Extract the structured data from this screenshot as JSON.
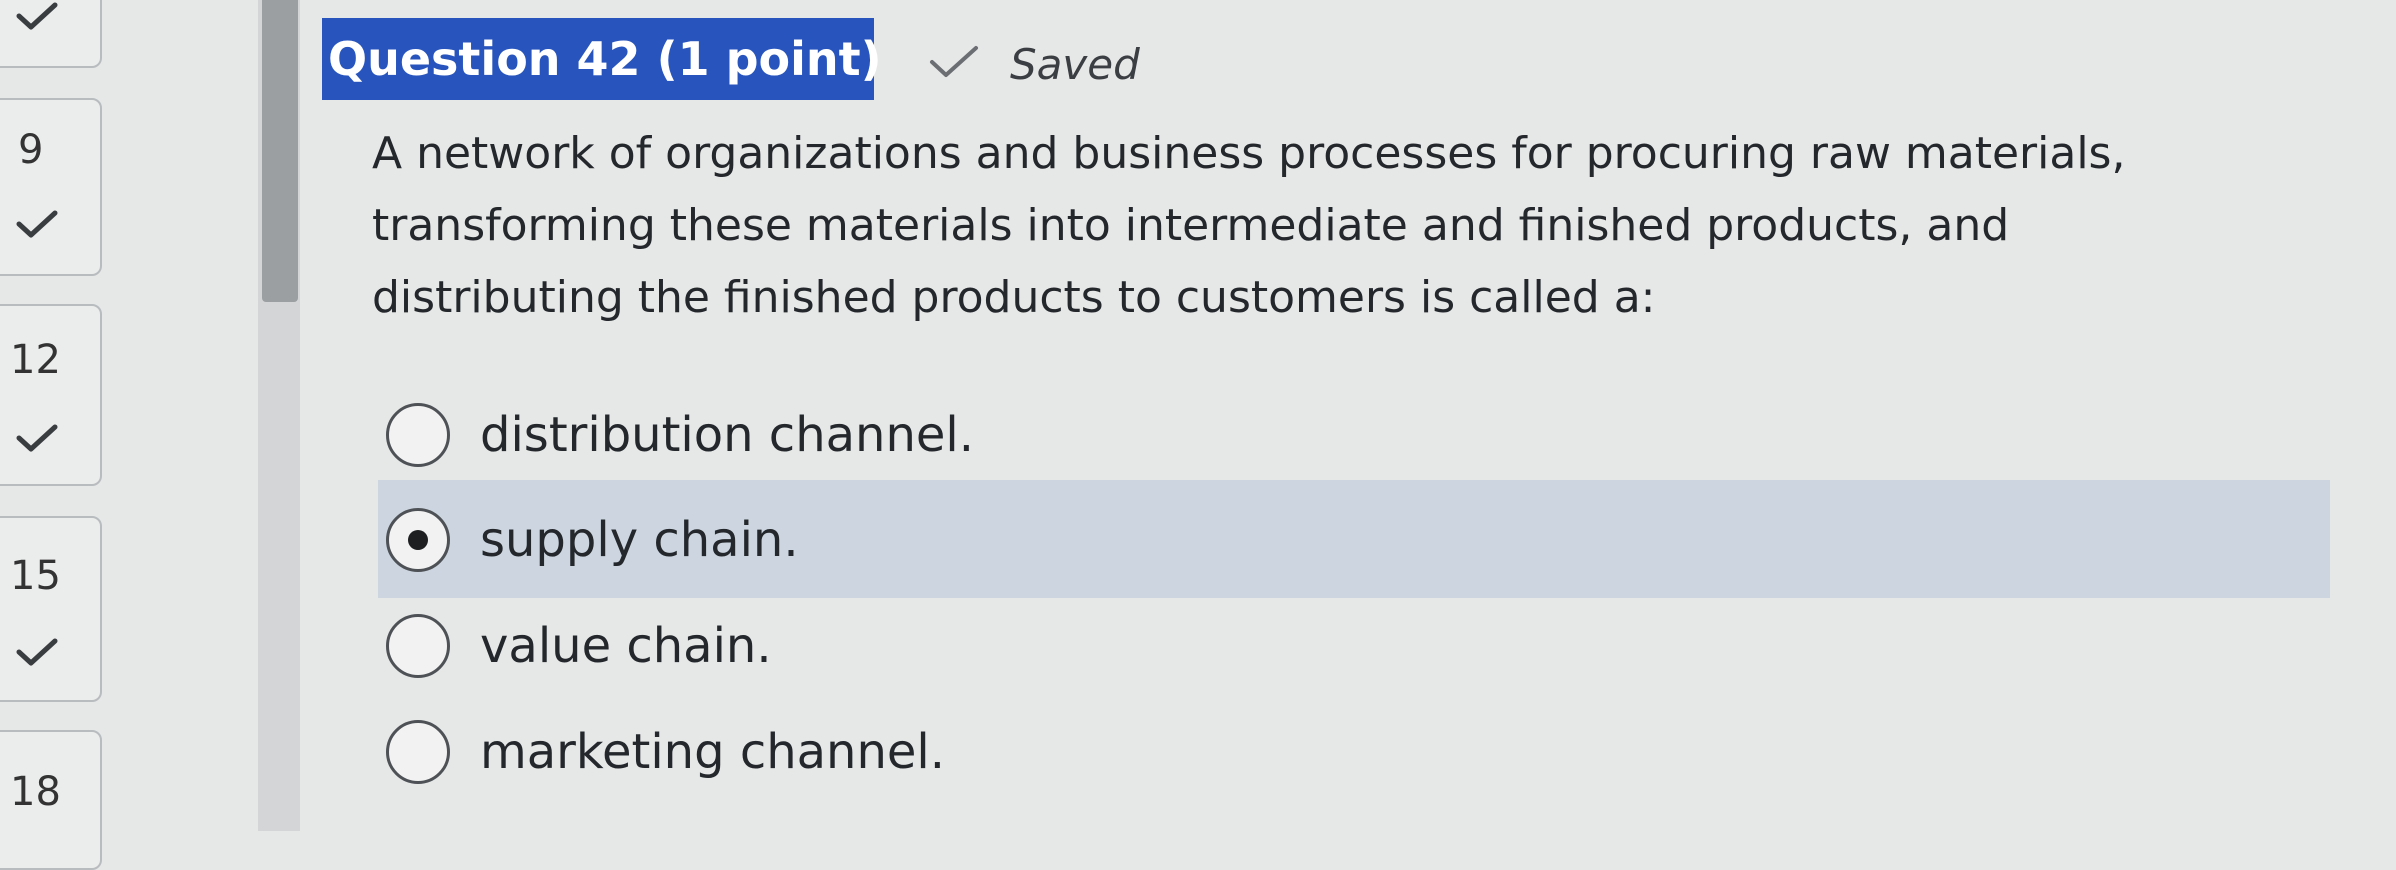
{
  "navigator": {
    "items": [
      {
        "number": "",
        "status": "answered"
      },
      {
        "number": "9",
        "status": "answered"
      },
      {
        "number": "12",
        "status": "answered"
      },
      {
        "number": "15",
        "status": "answered"
      },
      {
        "number": "18",
        "status": ""
      }
    ]
  },
  "question": {
    "header": "Question 42 (1 point)",
    "saved_label": "Saved",
    "text_lines": [
      "A network of organizations and business processes for procuring raw materials,",
      "transforming these materials into intermediate and finished products, and",
      "distributing the finished products to customers is called a:"
    ],
    "options": [
      {
        "label": "distribution channel.",
        "selected": false
      },
      {
        "label": "supply chain.",
        "selected": true
      },
      {
        "label": "value chain.",
        "selected": false
      },
      {
        "label": "marketing channel.",
        "selected": false
      }
    ]
  },
  "colors": {
    "header_bg": "#2855bd",
    "selected_row_bg": "#cdd6e0",
    "page_bg": "#e6e7e7"
  }
}
